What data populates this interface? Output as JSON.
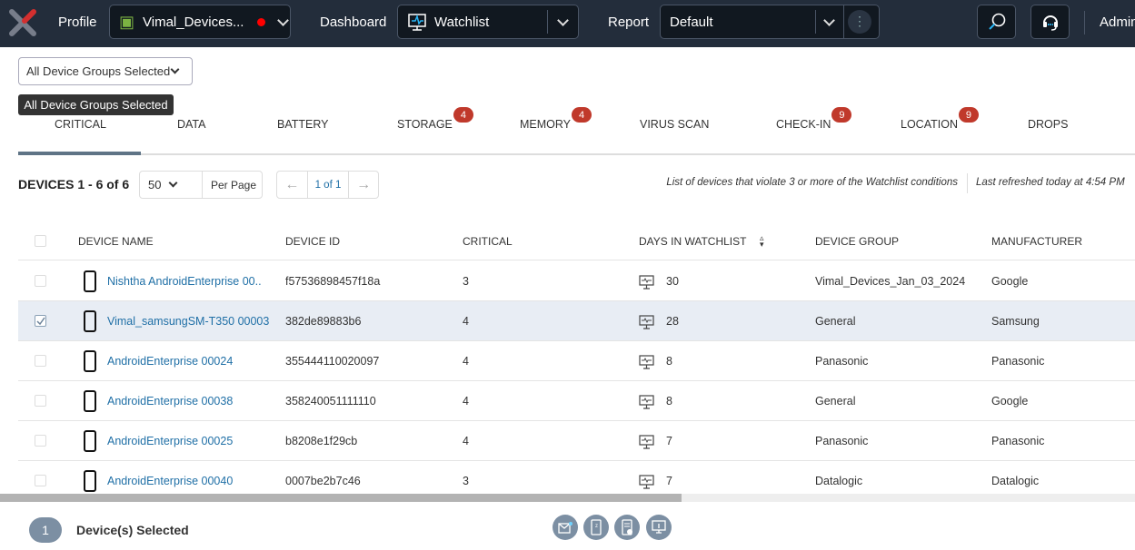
{
  "header": {
    "profile_label": "Profile",
    "profile_value": "Vimal_Devices...",
    "dashboard_label": "Dashboard",
    "dashboard_value": "Watchlist",
    "report_label": "Report",
    "report_value": "Default",
    "user": "Admin",
    "status_color": "#ff0000"
  },
  "filter": {
    "group_select": "All Device Groups Selected",
    "tooltip": "All Device Groups Selected"
  },
  "tabs": [
    {
      "label": "CRITICAL",
      "active": true
    },
    {
      "label": "DATA"
    },
    {
      "label": "BATTERY"
    },
    {
      "label": "STORAGE",
      "badge": "4"
    },
    {
      "label": "MEMORY",
      "badge": "4"
    },
    {
      "label": "VIRUS SCAN"
    },
    {
      "label": "CHECK-IN",
      "badge": "9"
    },
    {
      "label": "LOCATION",
      "badge": "9"
    },
    {
      "label": "DROPS"
    }
  ],
  "toolbar": {
    "count": "DEVICES 1 - 6 of 6",
    "per_page_value": "50",
    "per_page_label": "Per Page",
    "page": "1 of 1",
    "note": "List of devices that violate 3 or more of the Watchlist conditions",
    "refreshed": "Last refreshed today at 4:54 PM"
  },
  "table": {
    "headers": [
      "DEVICE NAME",
      "DEVICE ID",
      "CRITICAL",
      "DAYS IN WATCHLIST",
      "DEVICE GROUP",
      "MANUFACTURER"
    ],
    "rows": [
      {
        "name": "Nishtha AndroidEnterprise 00..",
        "id": "f57536898457f18a",
        "critical": "3",
        "days": "30",
        "group": "Vimal_Devices_Jan_03_2024",
        "manufacturer": "Google",
        "checked": false
      },
      {
        "name": "Vimal_samsungSM-T350 00003",
        "id": "382de89883b6",
        "critical": "4",
        "days": "28",
        "group": "General",
        "manufacturer": "Samsung",
        "checked": true
      },
      {
        "name": "AndroidEnterprise 00024",
        "id": "355444110020097",
        "critical": "4",
        "days": "8",
        "group": "Panasonic",
        "manufacturer": "Panasonic",
        "checked": false
      },
      {
        "name": "AndroidEnterprise 00038",
        "id": "358240051111110",
        "critical": "4",
        "days": "8",
        "group": "General",
        "manufacturer": "Google",
        "checked": false
      },
      {
        "name": "AndroidEnterprise 00025",
        "id": "b8208e1f29cb",
        "critical": "4",
        "days": "7",
        "group": "Panasonic",
        "manufacturer": "Panasonic",
        "checked": false
      },
      {
        "name": "AndroidEnterprise 00040",
        "id": "0007be2b7c46",
        "critical": "3",
        "days": "7",
        "group": "Datalogic",
        "manufacturer": "Datalogic",
        "checked": false
      }
    ]
  },
  "footer": {
    "selected_count": "1",
    "selected_label": "Device(s) Selected",
    "actions": [
      "message-icon",
      "sleep-device-icon",
      "device-report-icon",
      "device-info-icon"
    ]
  }
}
